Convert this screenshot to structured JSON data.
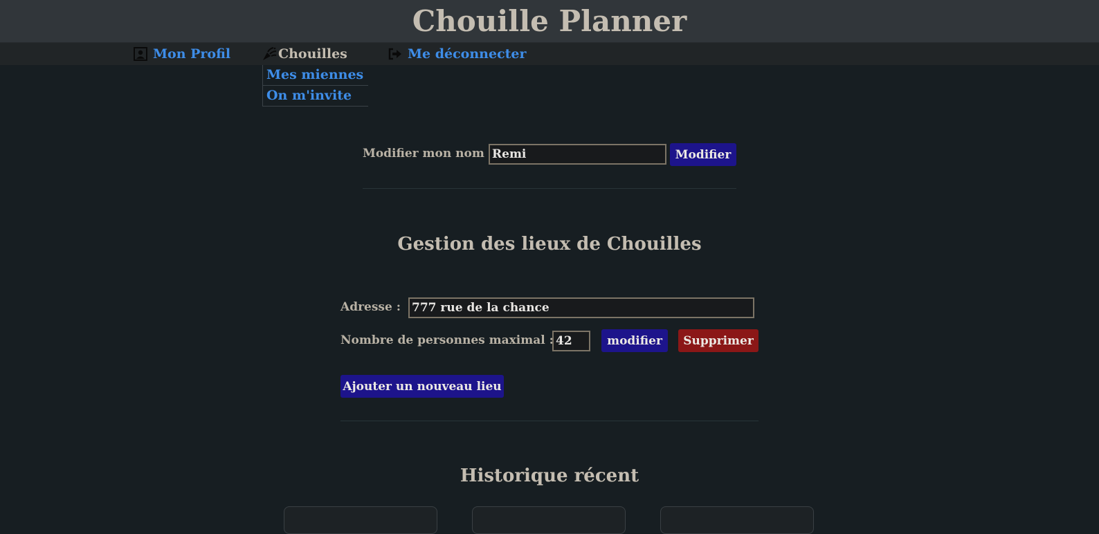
{
  "header": {
    "title": "Chouille Planner"
  },
  "nav": {
    "profil": {
      "label": "Mon Profil",
      "icon": "profile-icon"
    },
    "chouilles": {
      "label": "Chouilles",
      "icon": "party-popper-icon"
    },
    "logout": {
      "label": "Me déconnecter",
      "icon": "logout-icon"
    },
    "dropdown": [
      {
        "label": "Mes miennes"
      },
      {
        "label": "On m'invite"
      }
    ]
  },
  "profile_form": {
    "label": "Modifier mon nom :",
    "value": "Remi",
    "button": "Modifier"
  },
  "places": {
    "title": "Gestion des lieux de Chouilles",
    "address_label": "Adresse :",
    "address_value": "777 rue de la chance",
    "capacity_label": "Nombre de personnes maximal :",
    "capacity_value": "42",
    "modify_button": "modifier",
    "delete_button": "Supprimer",
    "add_button": "Ajouter un nouveau lieu"
  },
  "history": {
    "title": "Historique récent"
  },
  "colors": {
    "background": "#171e22",
    "header": "#31363a",
    "link": "#3e8de8",
    "primary_button": "#1d148b",
    "danger_button": "#8b1717"
  }
}
